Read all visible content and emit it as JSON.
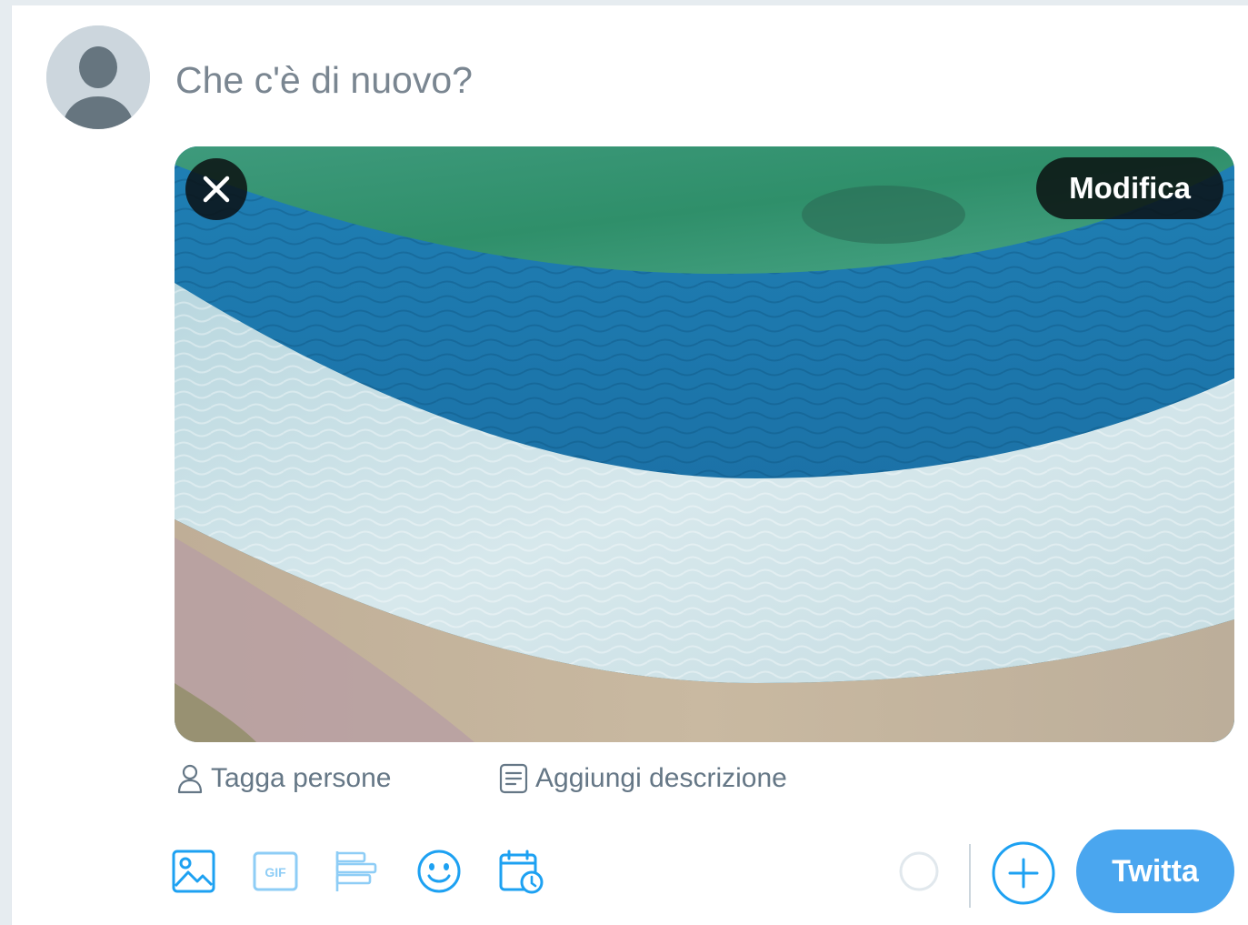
{
  "composer": {
    "placeholder": "Che c'è di nuovo?"
  },
  "media": {
    "edit_label": "Modifica",
    "remove_icon": "close-icon"
  },
  "media_actions": {
    "tag_people": "Tagga persone",
    "add_description": "Aggiungi descrizione"
  },
  "toolbar": {
    "icons": [
      "image-icon",
      "gif-icon",
      "poll-icon",
      "emoji-icon",
      "schedule-icon"
    ],
    "gif_label": "GIF"
  },
  "actions": {
    "tweet_label": "Twitta"
  },
  "colors": {
    "accent": "#1da1f2",
    "button": "#4aa6ef",
    "secondary_text": "#657786"
  }
}
